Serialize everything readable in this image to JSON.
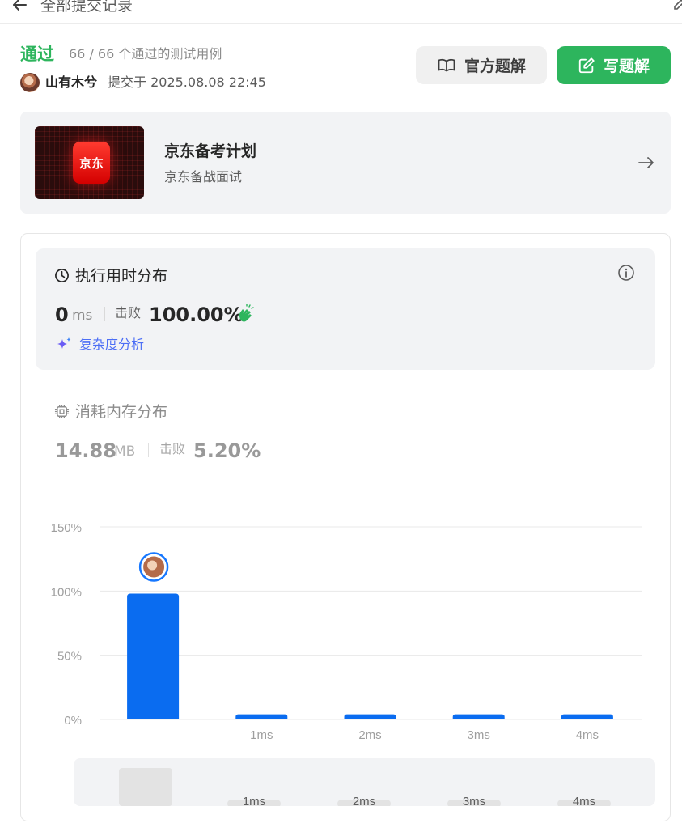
{
  "header": {
    "title": "全部提交记录"
  },
  "submission": {
    "status": "通过",
    "cases": "66 / 66 个通过的测试用例",
    "author": "山有木兮",
    "submitted_at": "提交于 2025.08.08 22:45"
  },
  "buttons": {
    "official": "官方题解",
    "write": "写题解"
  },
  "promo": {
    "logo_text": "京东",
    "title": "京东备考计划",
    "subtitle": "京东备战面试"
  },
  "runtime": {
    "title": "执行用时分布",
    "value": "0",
    "unit": "ms",
    "beat_label": "击败",
    "beat_value": "100.00%",
    "complexity_link": "复杂度分析"
  },
  "memory": {
    "title": "消耗内存分布",
    "value": "14.88",
    "unit": "MB",
    "beat_label": "击败",
    "beat_value": "5.20%"
  },
  "colors": {
    "accent": "#2db55d",
    "bar": "#0a6cf0",
    "link": "#4c6ef5"
  },
  "chart_data": {
    "type": "bar",
    "categories": [
      "",
      "1ms",
      "2ms",
      "3ms",
      "4ms"
    ],
    "values": [
      98,
      4,
      4,
      4,
      4
    ],
    "ylim": [
      0,
      150
    ],
    "yticks": [
      "0%",
      "50%",
      "100%",
      "150%"
    ],
    "ytick_values": [
      0,
      50,
      100,
      150
    ],
    "grid": true,
    "highlight_index": 0
  },
  "minimap": {
    "labels": [
      "1ms",
      "2ms",
      "3ms",
      "4ms"
    ]
  }
}
